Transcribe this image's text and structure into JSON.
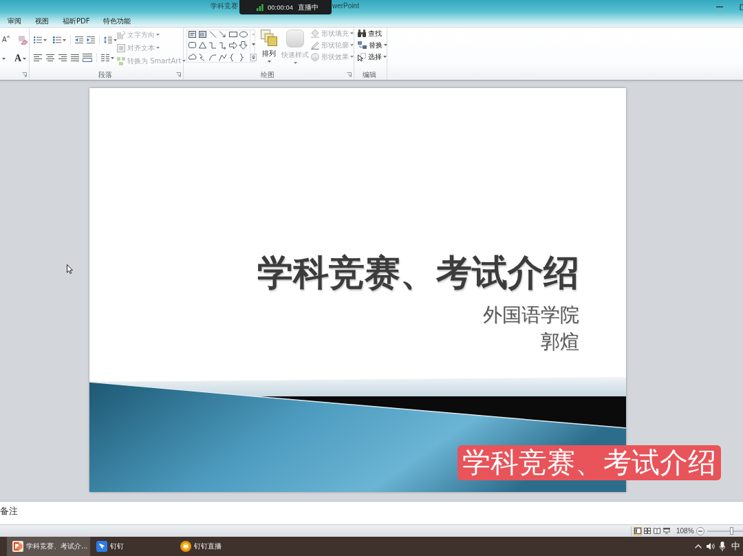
{
  "window": {
    "title_start": "学科竞赛",
    "title_end": "werPoint"
  },
  "live_indicator": {
    "timer": "00:00:04",
    "status": "直播中"
  },
  "ribbon_tabs": [
    {
      "label": "审阅",
      "selected": false
    },
    {
      "label": "视图",
      "selected": false
    },
    {
      "label": "福昕PDF",
      "selected": false
    },
    {
      "label": "特色功能",
      "selected": false
    }
  ],
  "ribbon_groups": [
    {
      "kind": "font",
      "grow_font_glyph": "A",
      "font_color_glyph": "A"
    },
    {
      "kind": "paragraph",
      "label": "段落",
      "commands": [
        {
          "label": "文字方向",
          "disabled": true,
          "dropdown": true
        },
        {
          "label": "对齐文本",
          "disabled": true,
          "dropdown": true
        },
        {
          "label": "转换为 SmartArt",
          "disabled": true,
          "dropdown": true
        }
      ]
    },
    {
      "kind": "drawing",
      "label": "绘图",
      "large_commands": [
        {
          "label": "排列",
          "disabled": false,
          "dropdown": true
        },
        {
          "label": "快速样式",
          "disabled": true,
          "dropdown": true
        }
      ],
      "commands": [
        {
          "label": "形状填充",
          "disabled": true,
          "dropdown": true
        },
        {
          "label": "形状轮廓",
          "disabled": true,
          "dropdown": true
        },
        {
          "label": "形状效果",
          "disabled": true,
          "dropdown": true
        }
      ]
    },
    {
      "kind": "editing",
      "label": "编辑",
      "commands": [
        {
          "label": "查找",
          "disabled": false,
          "dropdown": false
        },
        {
          "label": "替换",
          "disabled": false,
          "dropdown": true
        },
        {
          "label": "选择",
          "disabled": false,
          "dropdown": true
        }
      ]
    }
  ],
  "slide": {
    "title": "学科竞赛、考试介绍",
    "subtitle_lines": [
      "外国语学院",
      "郭煊"
    ]
  },
  "video_caption": "学科竞赛、考试介绍",
  "notes_pane": {
    "label": "备注"
  },
  "status_bar": {
    "views": [
      {
        "selected": true
      },
      {
        "selected": false
      },
      {
        "selected": false
      },
      {
        "selected": false
      }
    ],
    "zoom": "108%",
    "zoom_slider": {
      "level": 0.68
    }
  },
  "taskbar": {
    "items": [
      {
        "kind": "powerpoint",
        "label": "学科竞赛、考试介...",
        "selected": true
      },
      {
        "kind": "dingtalk",
        "label": "钉钉",
        "selected": false
      },
      {
        "kind": "dingtalk_live",
        "label": "钉钉直播",
        "selected": false
      }
    ],
    "input_method": "中"
  }
}
